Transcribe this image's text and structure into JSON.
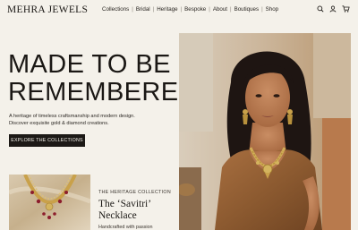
{
  "brand": {
    "logo": "MEHRA JEWELS"
  },
  "nav": {
    "items": [
      "Collections",
      "Bridal",
      "Heritage",
      "Bespoke",
      "About",
      "Boutiques",
      "Shop"
    ]
  },
  "header_icons": [
    "search-icon",
    "user-icon",
    "cart-icon"
  ],
  "hero": {
    "headline_line1": "MADE TO BE",
    "headline_line2": "REMEMBERED.",
    "subtext_line1": "A heritage of timeless craftsmanship and modern design.",
    "subtext_line2": "Discover exquisite gold & diamond creations.",
    "cta_label": "EXPLORE THE COLLECTIONS"
  },
  "featured": {
    "kicker": "THE HERITAGE COLLECTION",
    "title_line1": "The ‘Savitri’",
    "title_line2": "Necklace",
    "description": "Handcrafted with passion"
  },
  "colors": {
    "background": "#f4f1ea",
    "text": "#1c1916",
    "button": "#1c1916",
    "gold": "#c9a14a"
  }
}
